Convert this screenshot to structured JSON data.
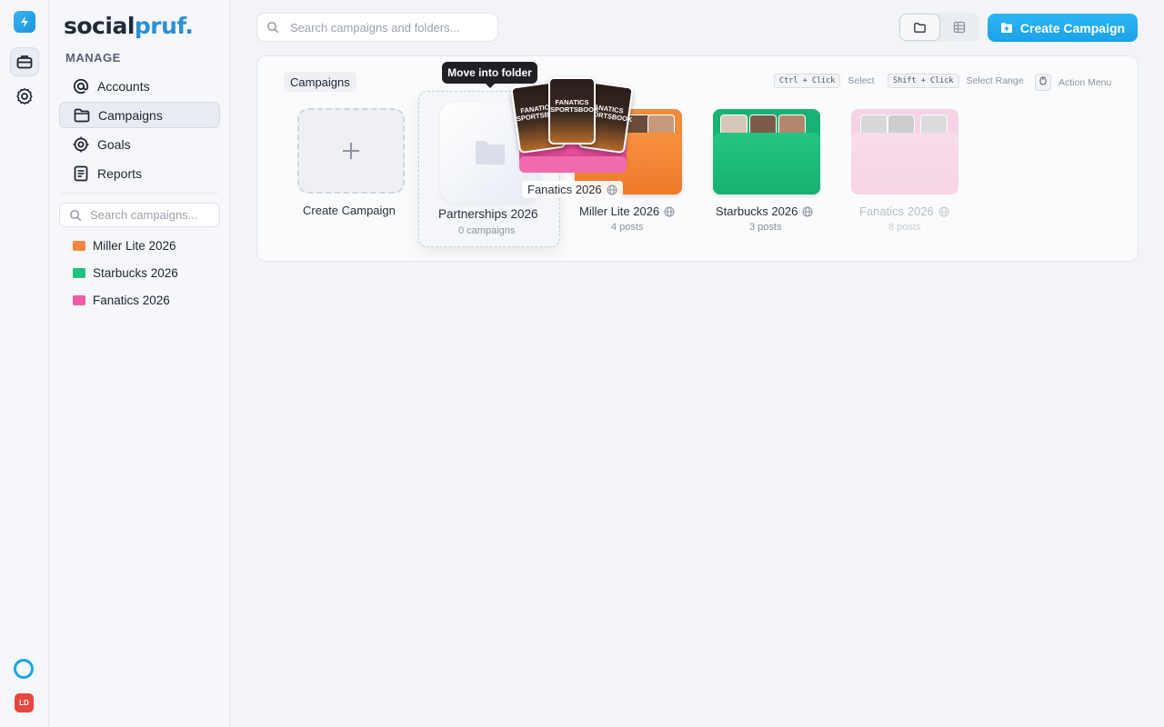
{
  "brand": {
    "part1": "social",
    "part2": "pruf."
  },
  "rail": {
    "avatar_initials": "LD"
  },
  "sidebar": {
    "section_label": "MANAGE",
    "nav": [
      {
        "label": "Accounts",
        "icon": "at-icon"
      },
      {
        "label": "Campaigns",
        "icon": "folder-icon",
        "active": true
      },
      {
        "label": "Goals",
        "icon": "target-icon"
      },
      {
        "label": "Reports",
        "icon": "report-icon"
      }
    ],
    "search_placeholder": "Search campaigns...",
    "campaigns": [
      {
        "label": "Miller Lite 2026",
        "color": "#f5873a"
      },
      {
        "label": "Starbucks 2026",
        "color": "#20c17f"
      },
      {
        "label": "Fanatics 2026",
        "color": "#ef5ba6"
      }
    ]
  },
  "topbar": {
    "search_placeholder": "Search campaigns and folders...",
    "create_label": "Create Campaign"
  },
  "panel": {
    "tag": "Campaigns",
    "hints": [
      {
        "key": "Ctrl + Click",
        "label": "Select"
      },
      {
        "key": "Shift + Click",
        "label": "Select Range"
      },
      {
        "label": "Action Menu"
      }
    ],
    "create_card_label": "Create Campaign",
    "drop_target": {
      "title": "Partnerships 2026",
      "sub": "0 campaigns"
    },
    "tooltip": "Move into folder",
    "dragging_label": "Fanatics 2026",
    "dragging_poster_text": "FANATICS SPORTSBOOK",
    "cards": [
      {
        "title": "Miller Lite 2026",
        "sub": "4 posts",
        "color": "#f5873a"
      },
      {
        "title": "Starbucks 2026",
        "sub": "3 posts",
        "color": "#20c17f"
      },
      {
        "title": "Fanatics 2026",
        "sub": "8 posts",
        "color": "#f6c4dd"
      }
    ]
  }
}
